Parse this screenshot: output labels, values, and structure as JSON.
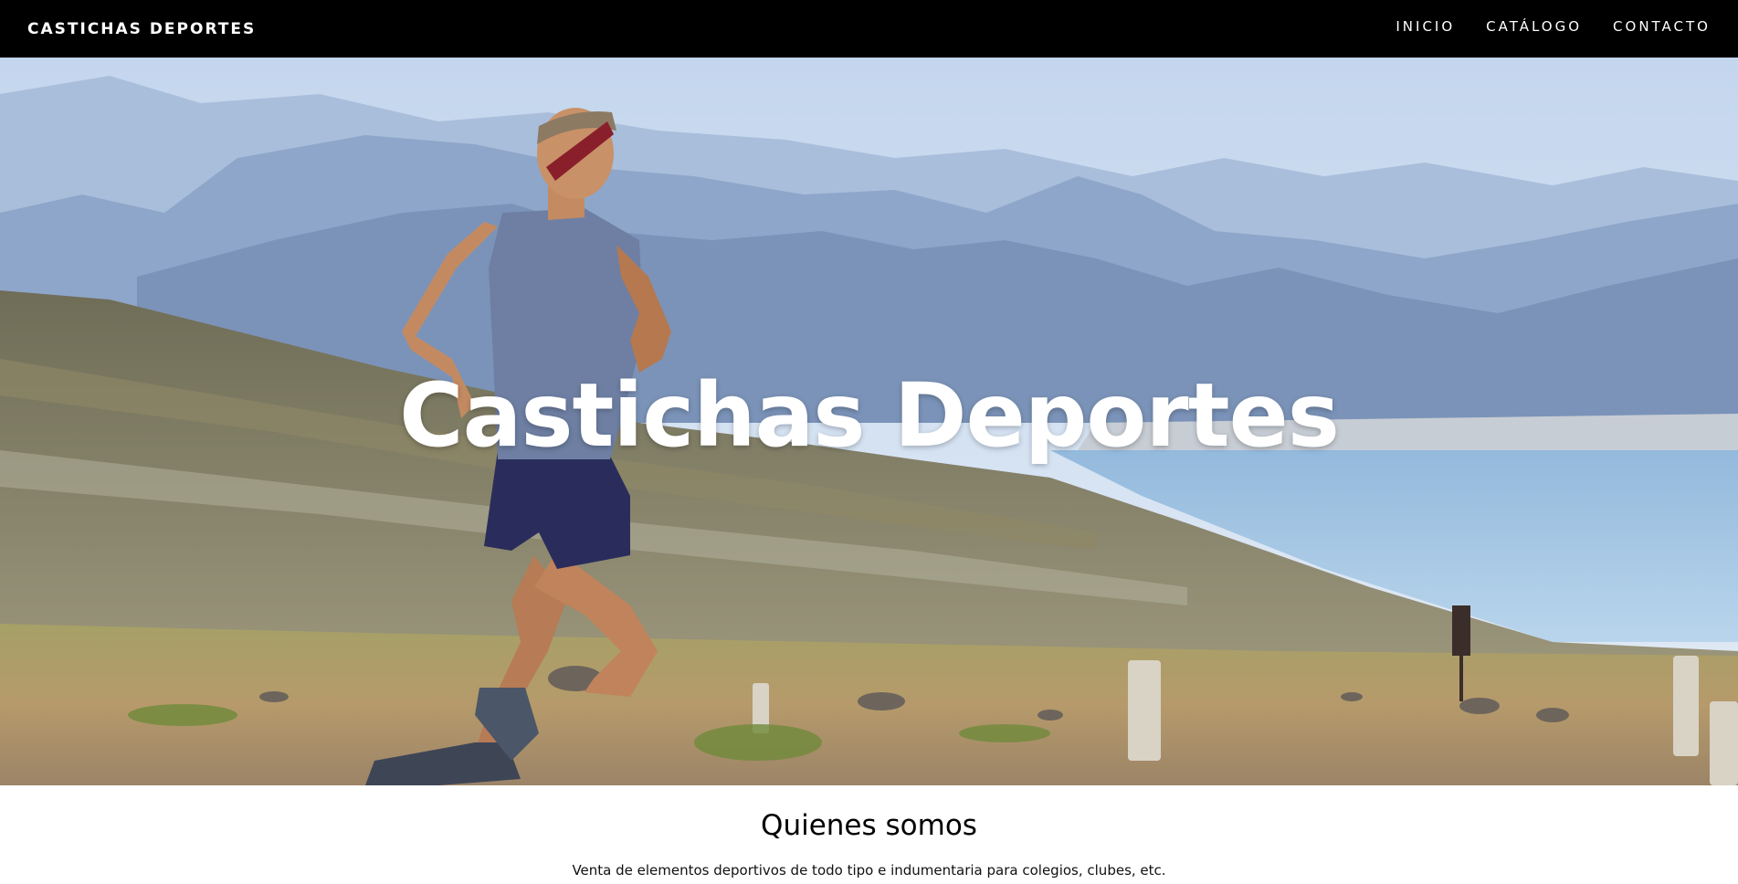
{
  "navbar": {
    "brand": "CASTICHAS DEPORTES",
    "links": [
      {
        "label": "INICIO"
      },
      {
        "label": "CATÁLOGO"
      },
      {
        "label": "CONTACTO"
      }
    ]
  },
  "hero": {
    "title": "Castichas Deportes",
    "image": "runner-on-mountain-road-icon"
  },
  "about": {
    "heading": "Quienes somos",
    "text": "Venta de elementos deportivos de todo tipo e indumentaria para colegios, clubes, etc."
  },
  "colors": {
    "navbar_bg": "#000000",
    "nav_text": "#ffffff",
    "hero_title": "#ffffff",
    "page_bg": "#ffffff"
  }
}
